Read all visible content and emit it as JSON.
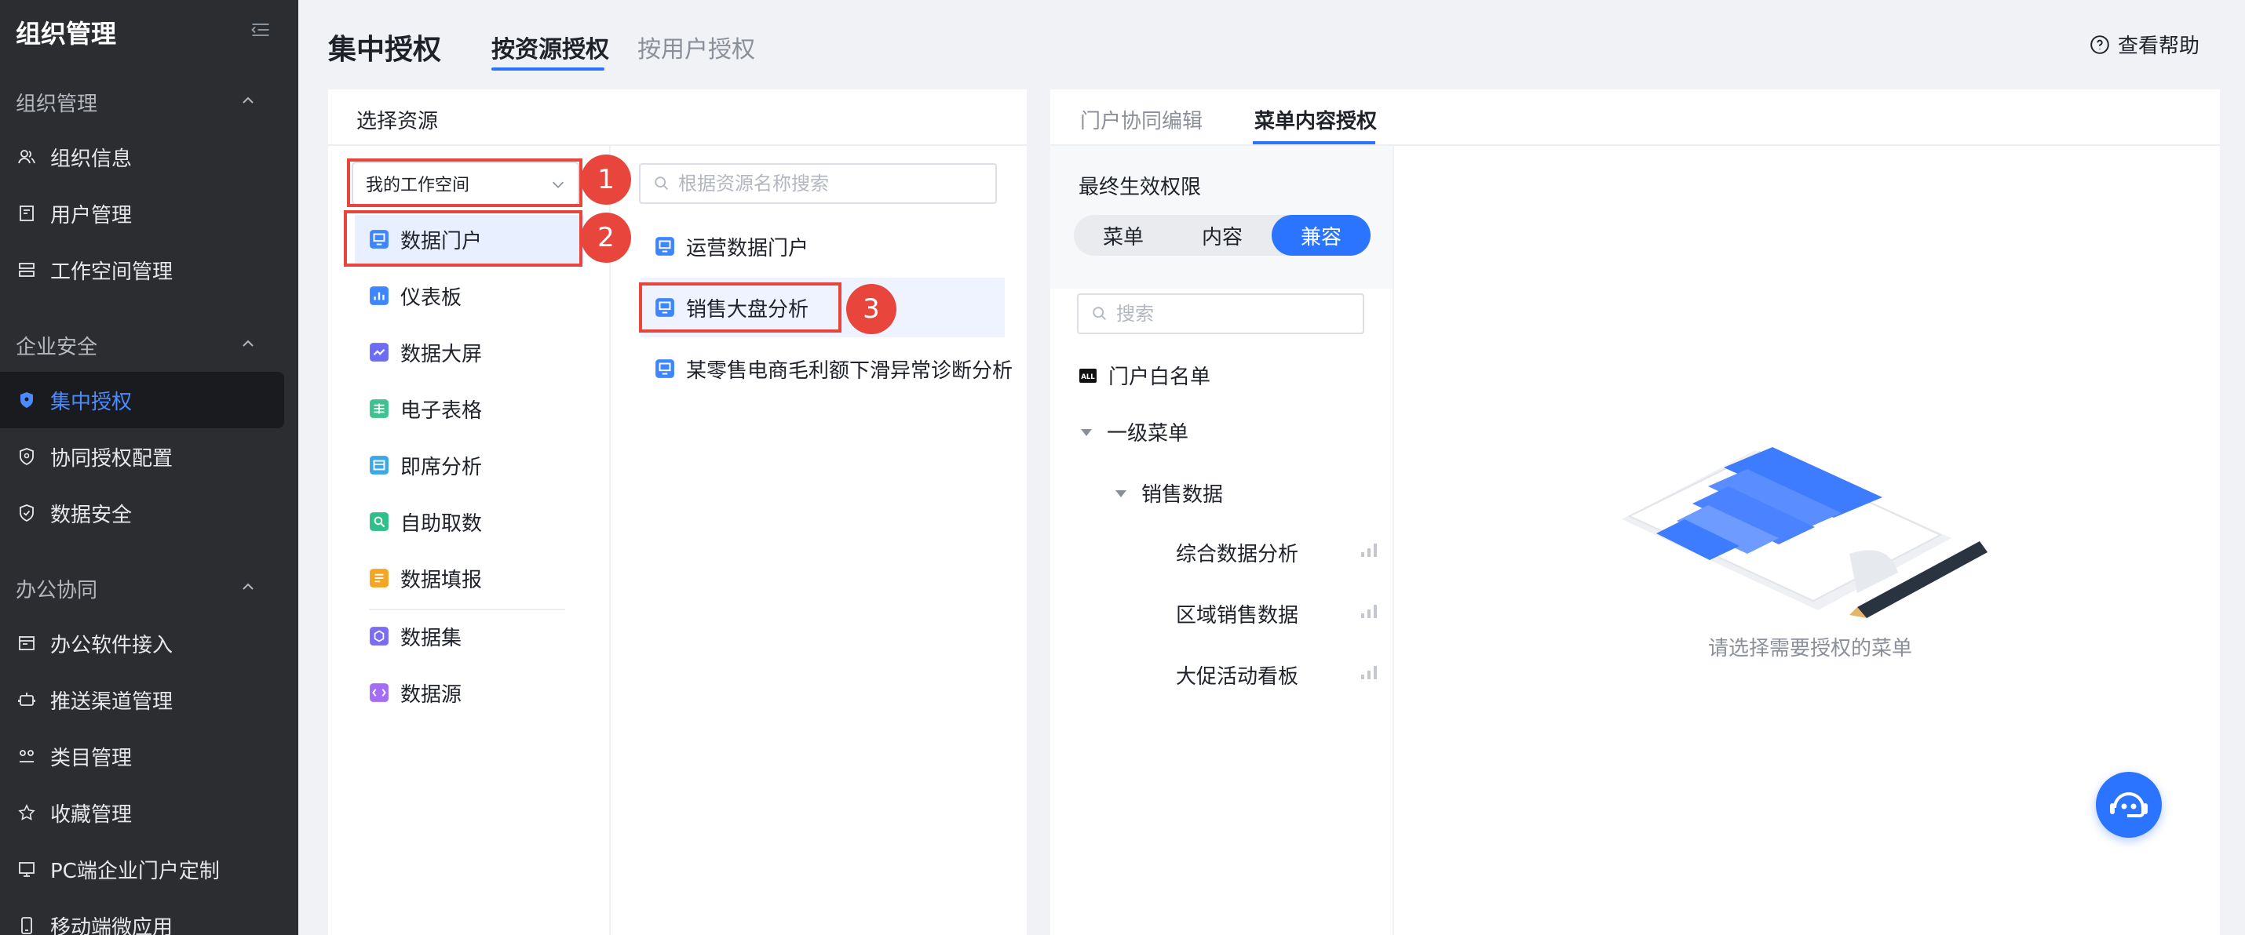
{
  "sidebar": {
    "title": "组织管理",
    "sections": [
      {
        "label": "组织管理",
        "items": [
          "组织信息",
          "用户管理",
          "工作空间管理"
        ]
      },
      {
        "label": "企业安全",
        "items": [
          "集中授权",
          "协同授权配置",
          "数据安全"
        ]
      },
      {
        "label": "办公协同",
        "items": [
          "办公软件接入",
          "推送渠道管理",
          "类目管理",
          "收藏管理",
          "PC端企业门户定制",
          "移动端微应用"
        ]
      }
    ]
  },
  "header": {
    "title": "集中授权",
    "tabs": [
      "按资源授权",
      "按用户授权"
    ],
    "help": "查看帮助"
  },
  "left_panel": {
    "title": "选择资源",
    "workspace": "我的工作空间",
    "resource_types": [
      "数据门户",
      "仪表板",
      "数据大屏",
      "电子表格",
      "即席分析",
      "自助取数",
      "数据填报",
      "数据集",
      "数据源"
    ],
    "search_placeholder": "根据资源名称搜索",
    "portals": [
      "运营数据门户",
      "销售大盘分析",
      "某零售电商毛利额下滑异常诊断分析"
    ],
    "steps": [
      "1",
      "2",
      "3"
    ]
  },
  "right_panel": {
    "tabs": [
      "门户协同编辑",
      "菜单内容授权"
    ],
    "effective_label": "最终生效权限",
    "segments": [
      "菜单",
      "内容",
      "兼容"
    ],
    "search_placeholder": "搜索",
    "tree": {
      "whitelist_badge": "ALL",
      "whitelist": "门户白名单",
      "level1": "一级菜单",
      "level2": "销售数据",
      "leaves": [
        "综合数据分析",
        "区域销售数据",
        "大促活动看板"
      ]
    },
    "empty_text": "请选择需要授权的菜单"
  },
  "colors": {
    "accent": "#2b74ff",
    "annotation": "#e8453c",
    "sidebar_bg": "#2b2d31"
  }
}
